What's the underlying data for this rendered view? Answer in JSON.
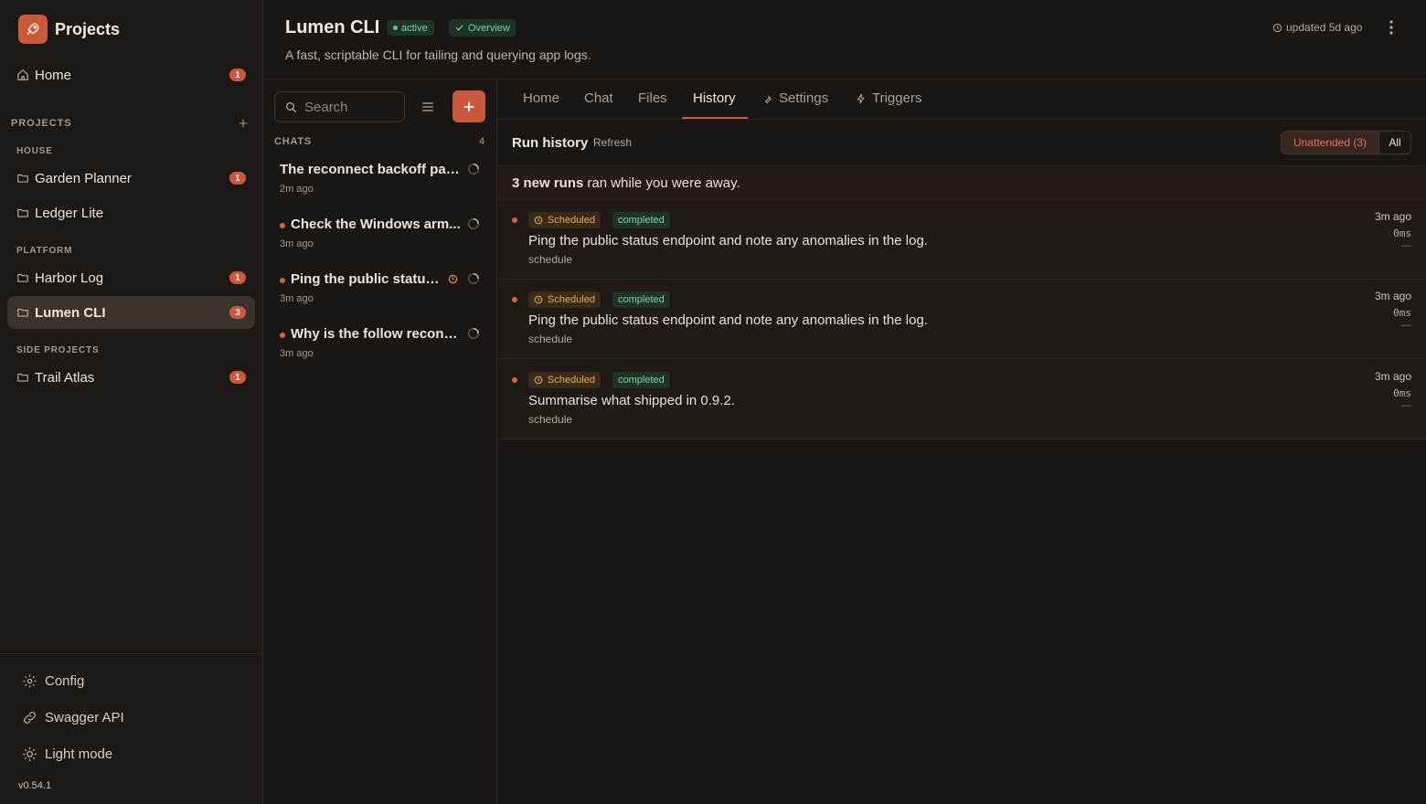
{
  "sidebar": {
    "brand_title": "Projects",
    "home": {
      "label": "Home",
      "badge": "1"
    },
    "projects_section": "PROJECTS",
    "groups": [
      {
        "title": "HOUSE",
        "items": [
          {
            "label": "Garden Planner",
            "badge": "1"
          },
          {
            "label": "Ledger Lite",
            "badge": ""
          }
        ]
      },
      {
        "title": "PLATFORM",
        "items": [
          {
            "label": "Harbor Log",
            "badge": "1"
          },
          {
            "label": "Lumen CLI",
            "badge": "3"
          }
        ]
      },
      {
        "title": "SIDE PROJECTS",
        "items": [
          {
            "label": "Trail Atlas",
            "badge": "1"
          }
        ]
      }
    ],
    "footer": {
      "config": "Config",
      "swagger": "Swagger API",
      "light_mode": "Light mode",
      "version": "v0.54.1"
    }
  },
  "header": {
    "title": "Lumen CLI",
    "status": "active",
    "overview": "Overview",
    "description": "A fast, scriptable CLI for tailing and querying app logs.",
    "updated": "updated 5d ago"
  },
  "chats": {
    "search_placeholder": "Search",
    "title": "CHATS",
    "count": "4",
    "items": [
      {
        "title": "The reconnect backoff patc...",
        "time": "2m ago"
      },
      {
        "title": "Check the Windows arm...",
        "time": "3m ago"
      },
      {
        "title": "Ping the public status ...",
        "time": "3m ago"
      },
      {
        "title": "Why is the follow reconn...",
        "time": "3m ago"
      }
    ]
  },
  "tabs": [
    "Home",
    "Chat",
    "Files",
    "History",
    "Settings",
    "Triggers"
  ],
  "history": {
    "title": "Run history",
    "refresh": "Refresh",
    "filter_unattended": "Unattended (3)",
    "filter_all": "All",
    "banner_bold": "3 new runs",
    "banner_rest": "ran while you were away.",
    "runs": [
      {
        "trigger": "Scheduled",
        "status": "completed",
        "prompt": "Ping the public status endpoint and note any anomalies in the log.",
        "source": "schedule",
        "time": "3m ago",
        "duration": "0ms",
        "extra": "—"
      },
      {
        "trigger": "Scheduled",
        "status": "completed",
        "prompt": "Ping the public status endpoint and note any anomalies in the log.",
        "source": "schedule",
        "time": "3m ago",
        "duration": "0ms",
        "extra": "—"
      },
      {
        "trigger": "Scheduled",
        "status": "completed",
        "prompt": "Summarise what shipped in 0.9.2.",
        "source": "schedule",
        "time": "3m ago",
        "duration": "0ms",
        "extra": "—"
      }
    ]
  },
  "colors": {
    "accent": "#c9593a",
    "success": "#7cd3a6",
    "warning": "#ecaa55",
    "background": "#191613"
  },
  "icons": [
    "rocket-icon",
    "home-icon",
    "plus-icon",
    "folder-icon",
    "gear-icon",
    "link-icon",
    "sun-icon",
    "clock-icon",
    "kebab-icon",
    "search-icon",
    "filter-icon",
    "spinner-icon",
    "wrench-icon",
    "bolt-icon",
    "check-icon"
  ]
}
